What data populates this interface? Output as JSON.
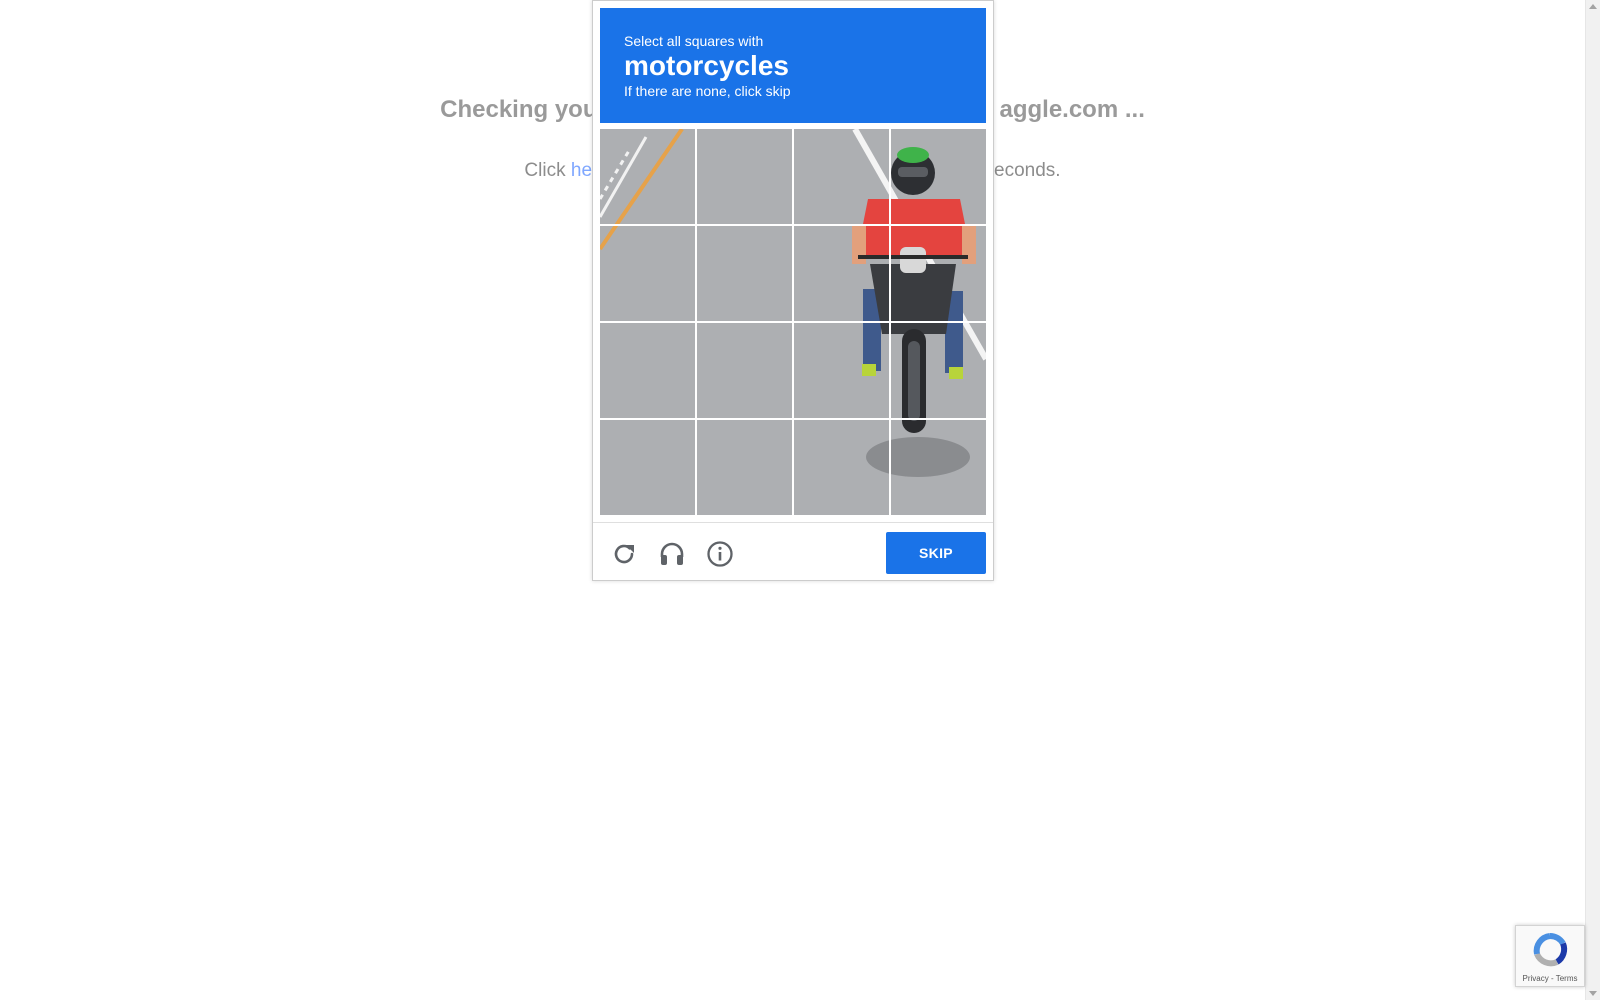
{
  "page": {
    "heading_start": "Checking you",
    "heading_end": "aggle.com ...",
    "line_prefix": "Click ",
    "line_link": "he",
    "line_suffix": "econds."
  },
  "captcha": {
    "instruction": "Select all squares with",
    "keyword": "motorcycles",
    "hint": "If there are none, click skip",
    "grid": {
      "rows": 4,
      "cols": 4
    },
    "icons": [
      "reload-icon",
      "audio-icon",
      "info-icon"
    ],
    "skip_label": "SKIP",
    "accent_color": "#1a73e8"
  },
  "badge": {
    "privacy_label": "Privacy",
    "separator": " - ",
    "terms_label": "Terms"
  }
}
